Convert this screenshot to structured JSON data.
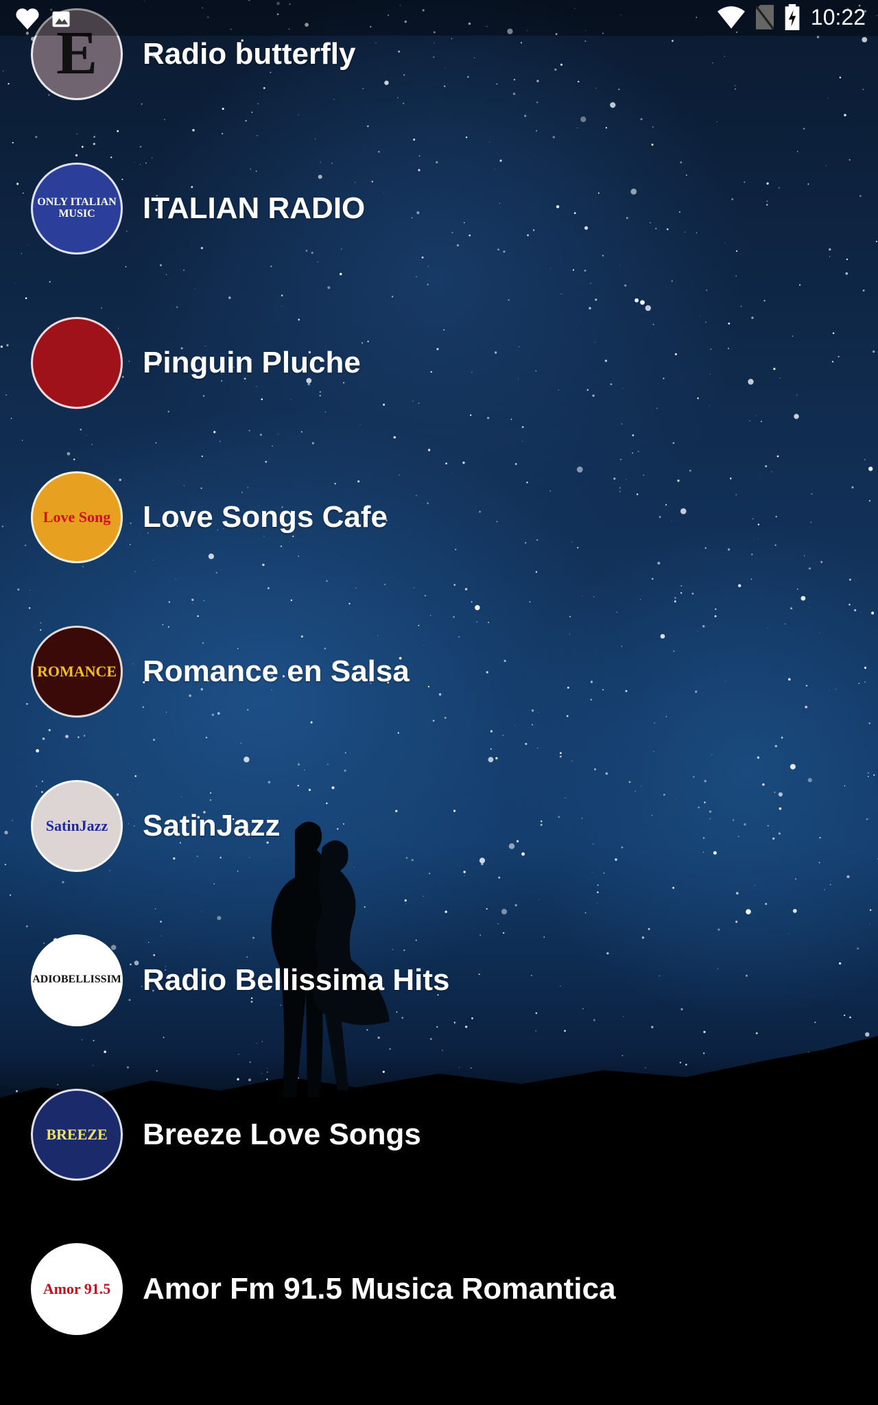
{
  "status_bar": {
    "time": "10:22",
    "left_icons": [
      "heart-icon",
      "image-icon"
    ],
    "right_icons": [
      "wifi-icon",
      "no-sim-icon",
      "battery-charging-icon"
    ]
  },
  "stations": [
    {
      "name": "Radio butterfly",
      "logo_text": "E",
      "logo_bg": "#6f6470",
      "logo_fg": "#111111"
    },
    {
      "name": "ITALIAN RADIO",
      "logo_text": "ONLY ITALIAN MUSIC",
      "logo_bg": "#2b3f9a",
      "logo_fg": "#ffffff"
    },
    {
      "name": "Pinguin Pluche",
      "logo_text": "",
      "logo_bg": "#a0121a",
      "logo_fg": "#ffffff"
    },
    {
      "name": "Love Songs Cafe",
      "logo_text": "Love Song",
      "logo_bg": "#e8a020",
      "logo_fg": "#d0101a"
    },
    {
      "name": "Romance en Salsa",
      "logo_text": "ROMANCE",
      "logo_bg": "#3a0a08",
      "logo_fg": "#f0c020"
    },
    {
      "name": "SatinJazz",
      "logo_text": "SatinJazz",
      "logo_bg": "#ddd4d4",
      "logo_fg": "#1c2aa0"
    },
    {
      "name": "Radio Bellissima Hits",
      "logo_text": "RADIOBELLISSIMA",
      "logo_bg": "#ffffff",
      "logo_fg": "#111111"
    },
    {
      "name": "Breeze Love Songs",
      "logo_text": "BREEZE",
      "logo_bg": "#1b2a6a",
      "logo_fg": "#f0e070"
    },
    {
      "name": "Amor Fm 91.5 Musica Romantica",
      "logo_text": "Amor 91.5",
      "logo_bg": "#ffffff",
      "logo_fg": "#c01020"
    }
  ]
}
